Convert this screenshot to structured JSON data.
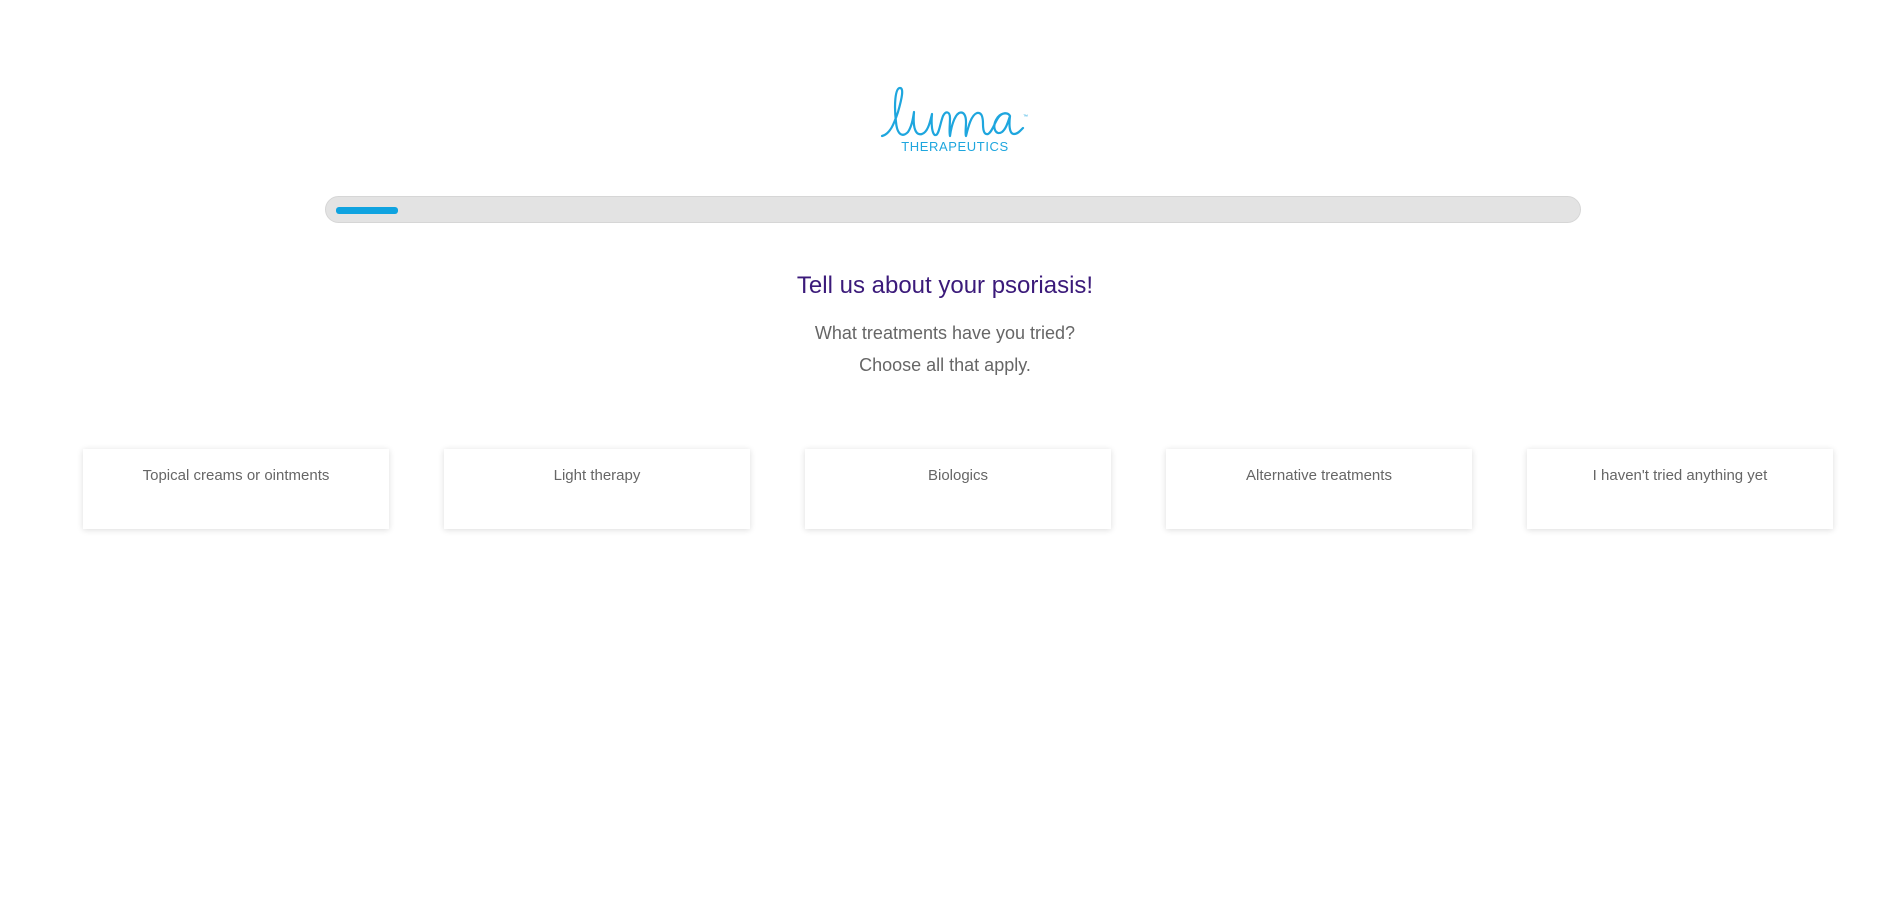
{
  "brand": {
    "logo_script": "luma",
    "logo_subtitle": "THERAPEUTICS",
    "logo_tm": "™",
    "color": "#1ea6de"
  },
  "progress": {
    "fraction": 0.05,
    "fill_color": "#0fa3e0",
    "track_color": "#e3e3e3"
  },
  "question": {
    "title": "Tell us about your psoriasis!",
    "prompt": "What treatments have you tried?",
    "hint": "Choose all that apply.",
    "title_color": "#3b1a7a"
  },
  "options": [
    {
      "label": "Topical creams or ointments"
    },
    {
      "label": "Light therapy"
    },
    {
      "label": "Biologics"
    },
    {
      "label": "Alternative treatments"
    },
    {
      "label": "I haven't tried anything yet"
    }
  ]
}
